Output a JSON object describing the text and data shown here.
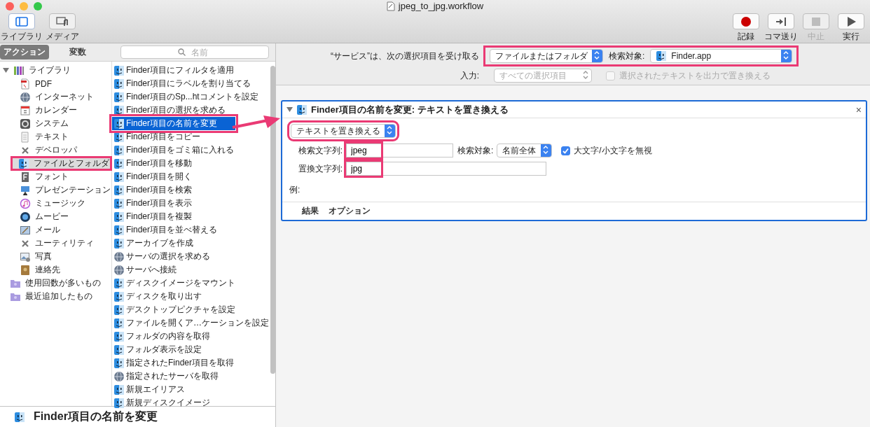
{
  "window": {
    "title": "jpeg_to_jpg.workflow"
  },
  "toolbar": {
    "left": [
      {
        "label": "ライブラリ",
        "kind": "library",
        "selected": true
      },
      {
        "label": "メディア",
        "kind": "media",
        "selected": false
      }
    ],
    "right": [
      {
        "label": "記録",
        "kind": "record",
        "disabled": false
      },
      {
        "label": "コマ送り",
        "kind": "step",
        "disabled": false
      },
      {
        "label": "中止",
        "kind": "stop",
        "disabled": true
      },
      {
        "label": "実行",
        "kind": "run",
        "disabled": false
      }
    ]
  },
  "library": {
    "tabs": [
      {
        "label": "アクション",
        "selected": true
      },
      {
        "label": "変数",
        "selected": false
      }
    ],
    "search": {
      "placeholder": "名前"
    },
    "categories": [
      {
        "label": "ライブラリ",
        "kind": "library",
        "expanded": true,
        "selected": false,
        "highlighted": false,
        "children": [
          {
            "label": "PDF",
            "kind": "pdf",
            "selected": false,
            "highlighted": false
          },
          {
            "label": "インターネット",
            "kind": "globe",
            "selected": false,
            "highlighted": false
          },
          {
            "label": "カレンダー",
            "kind": "calendar",
            "selected": false,
            "highlighted": false
          },
          {
            "label": "システム",
            "kind": "system",
            "selected": false,
            "highlighted": false
          },
          {
            "label": "テキスト",
            "kind": "text",
            "selected": false,
            "highlighted": false
          },
          {
            "label": "デベロッパ",
            "kind": "tools",
            "selected": false,
            "highlighted": false
          },
          {
            "label": "ファイルとフォルダ",
            "kind": "finder",
            "selected": true,
            "highlighted": true
          },
          {
            "label": "フォント",
            "kind": "font",
            "selected": false,
            "highlighted": false
          },
          {
            "label": "プレゼンテーション",
            "kind": "easel",
            "selected": false,
            "highlighted": false
          },
          {
            "label": "ミュージック",
            "kind": "music",
            "selected": false,
            "highlighted": false
          },
          {
            "label": "ムービー",
            "kind": "movie",
            "selected": false,
            "highlighted": false
          },
          {
            "label": "メール",
            "kind": "mail",
            "selected": false,
            "highlighted": false
          },
          {
            "label": "ユーティリティ",
            "kind": "tools",
            "selected": false,
            "highlighted": false
          },
          {
            "label": "写真",
            "kind": "photo",
            "selected": false,
            "highlighted": false
          },
          {
            "label": "連絡先",
            "kind": "contacts",
            "selected": false,
            "highlighted": false
          }
        ]
      },
      {
        "label": "使用回数が多いもの",
        "kind": "folder",
        "selected": false,
        "highlighted": false
      },
      {
        "label": "最近追加したもの",
        "kind": "folder",
        "selected": false,
        "highlighted": false
      }
    ],
    "actions": [
      {
        "label": "Finder項目にフィルタを適用",
        "kind": "finder",
        "selected": false,
        "highlighted": false
      },
      {
        "label": "Finder項目にラベルを割り当てる",
        "kind": "finder",
        "selected": false,
        "highlighted": false
      },
      {
        "label": "Finder項目のSp...htコメントを設定",
        "kind": "finder",
        "selected": false,
        "highlighted": false
      },
      {
        "label": "Finder項目の選択を求める",
        "kind": "finder",
        "selected": false,
        "highlighted": false
      },
      {
        "label": "Finder項目の名前を変更",
        "kind": "finder",
        "selected": true,
        "highlighted": true
      },
      {
        "label": "Finder項目をコピー",
        "kind": "finder",
        "selected": false,
        "highlighted": false
      },
      {
        "label": "Finder項目をゴミ箱に入れる",
        "kind": "finder",
        "selected": false,
        "highlighted": false
      },
      {
        "label": "Finder項目を移動",
        "kind": "finder",
        "selected": false,
        "highlighted": false
      },
      {
        "label": "Finder項目を開く",
        "kind": "finder",
        "selected": false,
        "highlighted": false
      },
      {
        "label": "Finder項目を検索",
        "kind": "finder",
        "selected": false,
        "highlighted": false
      },
      {
        "label": "Finder項目を表示",
        "kind": "finder",
        "selected": false,
        "highlighted": false
      },
      {
        "label": "Finder項目を複製",
        "kind": "finder",
        "selected": false,
        "highlighted": false
      },
      {
        "label": "Finder項目を並べ替える",
        "kind": "finder",
        "selected": false,
        "highlighted": false
      },
      {
        "label": "アーカイブを作成",
        "kind": "finder",
        "selected": false,
        "highlighted": false
      },
      {
        "label": "サーバの選択を求める",
        "kind": "globe",
        "selected": false,
        "highlighted": false
      },
      {
        "label": "サーバへ接続",
        "kind": "globe",
        "selected": false,
        "highlighted": false
      },
      {
        "label": "ディスクイメージをマウント",
        "kind": "finder",
        "selected": false,
        "highlighted": false
      },
      {
        "label": "ディスクを取り出す",
        "kind": "finder",
        "selected": false,
        "highlighted": false
      },
      {
        "label": "デスクトップピクチャを設定",
        "kind": "finder",
        "selected": false,
        "highlighted": false
      },
      {
        "label": "ファイルを開くア…ケーションを設定",
        "kind": "finder",
        "selected": false,
        "highlighted": false
      },
      {
        "label": "フォルダの内容を取得",
        "kind": "finder",
        "selected": false,
        "highlighted": false
      },
      {
        "label": "フォルダ表示を設定",
        "kind": "finder",
        "selected": false,
        "highlighted": false
      },
      {
        "label": "指定されたFinder項目を取得",
        "kind": "finder",
        "selected": false,
        "highlighted": false
      },
      {
        "label": "指定されたサーバを取得",
        "kind": "globe",
        "selected": false,
        "highlighted": false
      },
      {
        "label": "新規エイリアス",
        "kind": "finder",
        "selected": false,
        "highlighted": false
      },
      {
        "label": "新規ディスクイメージ",
        "kind": "finder",
        "selected": false,
        "highlighted": false
      }
    ],
    "description": {
      "title": "Finder項目の名前を変更"
    }
  },
  "workflow": {
    "highlighted": true,
    "receives_label": "“サービス”は、次の選択項目を受け取る",
    "receives_value": "ファイルまたはフォルダ",
    "target_label": "検索対象:",
    "target_value": "Finder.app",
    "input_label": "入力:",
    "input_value": "すべての選択項目",
    "input_disabled": true,
    "replace_checkbox": {
      "label": "選択されたテキストを出力で置き換える",
      "checked": false,
      "disabled": true
    }
  },
  "action": {
    "title": "Finder項目の名前を変更: テキストを置き換える",
    "expanded": true,
    "close": "×",
    "mode": {
      "value": "テキストを置き換える",
      "highlighted": true
    },
    "fields": [
      {
        "label": "検索文字列:",
        "value": "jpeg",
        "highlighted": true
      },
      {
        "label": "置換文字列:",
        "value": "jpg",
        "highlighted": true
      }
    ],
    "scope": {
      "label": "検索対象:",
      "value": "名前全体"
    },
    "ignore_case": {
      "label": "大文字/小文字を無視",
      "checked": true
    },
    "example_label": "例:",
    "tabs": [
      {
        "label": "結果"
      },
      {
        "label": "オプション"
      }
    ]
  }
}
